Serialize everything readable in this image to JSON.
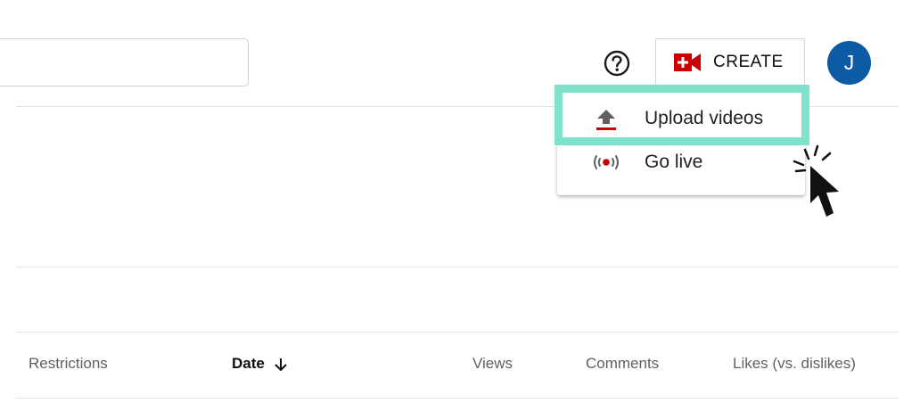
{
  "header": {
    "search": {
      "value": "",
      "placeholder": ""
    },
    "help_icon": "help-circle-icon",
    "create_label": "CREATE",
    "create_icon": "video-camera-plus-icon",
    "avatar_initial": "J"
  },
  "create_menu": {
    "items": [
      {
        "label": "Upload videos",
        "icon": "upload-icon",
        "highlighted": true
      },
      {
        "label": "Go live",
        "icon": "live-broadcast-icon",
        "highlighted": false
      }
    ]
  },
  "table": {
    "columns": [
      {
        "label": "Restrictions",
        "sorted": false
      },
      {
        "label": "Date",
        "sorted": true,
        "sort_direction": "descending"
      },
      {
        "label": "Views",
        "sorted": false
      },
      {
        "label": "Comments",
        "sorted": false
      },
      {
        "label": "Likes (vs. dislikes)",
        "sorted": false
      }
    ]
  },
  "colors": {
    "brand_red": "#cc0000",
    "avatar_blue": "#0d5aa5",
    "highlight_teal": "#7fe3cc"
  }
}
